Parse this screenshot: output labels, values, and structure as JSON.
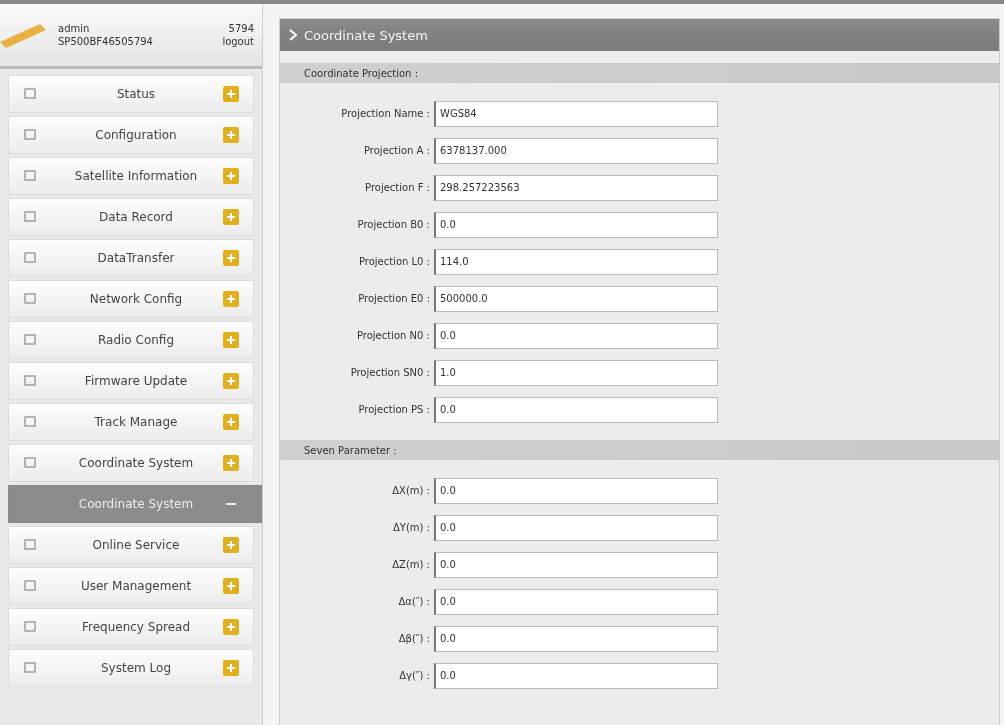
{
  "user": {
    "name": "admin",
    "serial": "SP500BF46505794",
    "code": "5794",
    "logout": "logout"
  },
  "menu": [
    {
      "label": "Status",
      "kind": "item",
      "selected": false
    },
    {
      "label": "Configuration",
      "kind": "item",
      "selected": false
    },
    {
      "label": "Satellite Information",
      "kind": "item",
      "selected": false
    },
    {
      "label": "Data Record",
      "kind": "item",
      "selected": false
    },
    {
      "label": "DataTransfer",
      "kind": "item",
      "selected": false
    },
    {
      "label": "Network Config",
      "kind": "item",
      "selected": false
    },
    {
      "label": "Radio Config",
      "kind": "item",
      "selected": false
    },
    {
      "label": "Firmware Update",
      "kind": "item",
      "selected": false
    },
    {
      "label": "Track Manage",
      "kind": "item",
      "selected": false
    },
    {
      "label": "Coordinate System",
      "kind": "item",
      "selected": false
    },
    {
      "label": "Coordinate System",
      "kind": "subitem",
      "selected": true
    },
    {
      "label": "Online Service",
      "kind": "item",
      "selected": false
    },
    {
      "label": "User Management",
      "kind": "item",
      "selected": false
    },
    {
      "label": "Frequency Spread",
      "kind": "item",
      "selected": false
    },
    {
      "label": "System Log",
      "kind": "item",
      "selected": false
    }
  ],
  "panel": {
    "title": "Coordinate System",
    "sections": [
      {
        "title": "Coordinate Projection :",
        "fields": [
          {
            "label": "Projection Name :",
            "value": "WGS84"
          },
          {
            "label": "Projection A :",
            "value": "6378137.000"
          },
          {
            "label": "Projection F :",
            "value": "298.257223563"
          },
          {
            "label": "Projection B0 :",
            "value": "0.0"
          },
          {
            "label": "Projection L0 :",
            "value": "114.0"
          },
          {
            "label": "Projection E0 :",
            "value": "500000.0"
          },
          {
            "label": "Projection N0 :",
            "value": "0.0"
          },
          {
            "label": "Projection SN0 :",
            "value": "1.0"
          },
          {
            "label": "Projection PS :",
            "value": "0.0"
          }
        ]
      },
      {
        "title": "Seven Parameter :",
        "fields": [
          {
            "label": "ΔX(m) :",
            "value": "0.0"
          },
          {
            "label": "ΔY(m) :",
            "value": "0.0"
          },
          {
            "label": "ΔZ(m) :",
            "value": "0.0"
          },
          {
            "label": "Δα(″) :",
            "value": "0.0"
          },
          {
            "label": "Δβ(″) :",
            "value": "0.0"
          },
          {
            "label": "Δγ(″) :",
            "value": "0.0"
          }
        ]
      }
    ]
  }
}
